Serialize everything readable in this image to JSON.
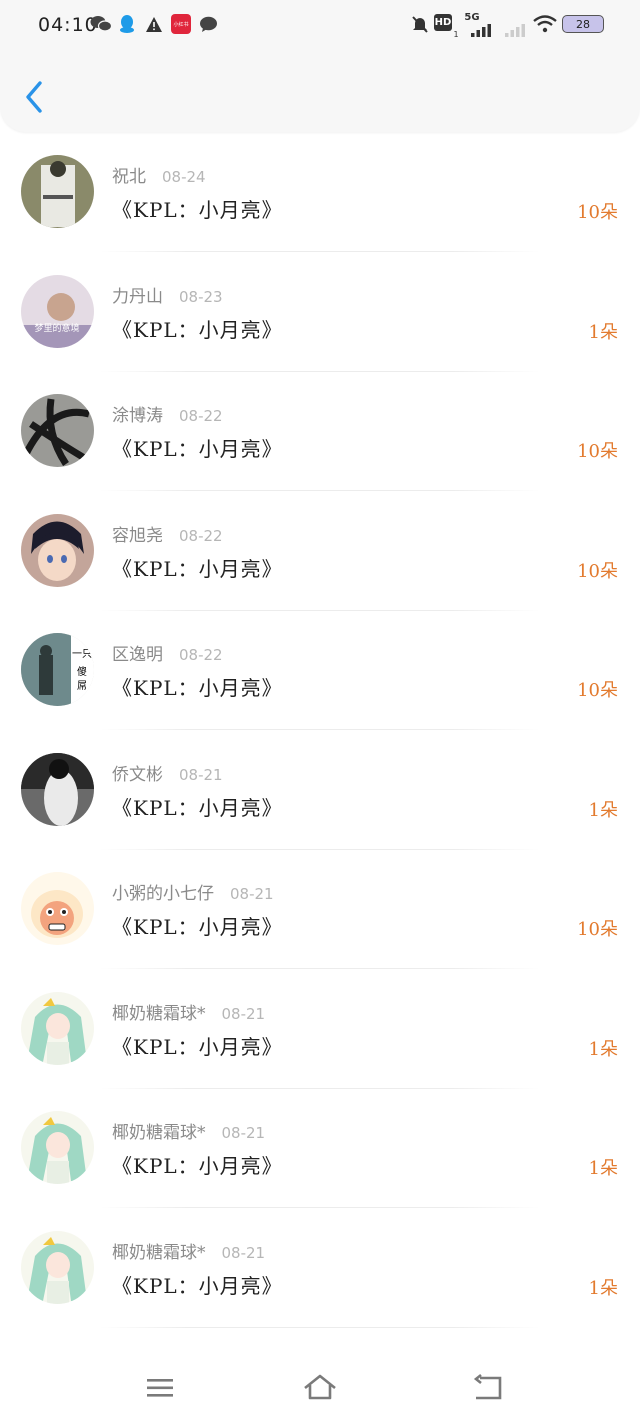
{
  "status_bar": {
    "time": "04:10",
    "network": "5G",
    "hd": "HD",
    "hd_sub": "1",
    "battery": "28",
    "notif_app_label": "小红书"
  },
  "header": {
    "back_icon": "chevron-left-icon",
    "accent": "#2a93e8"
  },
  "rows": [
    {
      "name": "祝北",
      "date": "08-24",
      "gift": "《KPL：小月亮》",
      "count": "10朵"
    },
    {
      "name": "力丹山",
      "date": "08-23",
      "gift": "《KPL：小月亮》",
      "count": "1朵",
      "avatar_text": "梦里的意境"
    },
    {
      "name": "涂博涛",
      "date": "08-22",
      "gift": "《KPL：小月亮》",
      "count": "10朵"
    },
    {
      "name": "容旭尧",
      "date": "08-22",
      "gift": "《KPL：小月亮》",
      "count": "10朵"
    },
    {
      "name": "区逸明",
      "date": "08-22",
      "gift": "《KPL：小月亮》",
      "count": "10朵",
      "avatar_text": "一只傻屌"
    },
    {
      "name": "侨文彬",
      "date": "08-21",
      "gift": "《KPL：小月亮》",
      "count": "1朵"
    },
    {
      "name": "小粥的小七仔",
      "date": "08-21",
      "gift": "《KPL：小月亮》",
      "count": "10朵"
    },
    {
      "name": "椰奶糖霜球*",
      "date": "08-21",
      "gift": "《KPL：小月亮》",
      "count": "1朵"
    },
    {
      "name": "椰奶糖霜球*",
      "date": "08-21",
      "gift": "《KPL：小月亮》",
      "count": "1朵"
    },
    {
      "name": "椰奶糖霜球*",
      "date": "08-21",
      "gift": "《KPL：小月亮》",
      "count": "1朵"
    }
  ],
  "colors": {
    "count": "#e27a2e",
    "name": "#8a8a8a",
    "date": "#b6b6b6"
  },
  "nav": {
    "menu_icon": "menu-icon",
    "home_icon": "home-icon",
    "back_icon": "return-icon"
  }
}
